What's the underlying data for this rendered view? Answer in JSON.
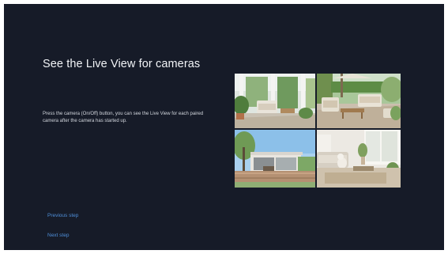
{
  "page": {
    "title": "See the Live View for cameras",
    "description": "Press the camera (On/Off) button, you can see the Live View for each paired camera after the camera has started up."
  },
  "camera_feeds": [
    {
      "name": "camera-1-porch"
    },
    {
      "name": "camera-2-patio"
    },
    {
      "name": "camera-3-deck"
    },
    {
      "name": "camera-4-living-room"
    }
  ],
  "navigation": {
    "previous_label": "Previous step",
    "next_label": "Next step"
  },
  "colors": {
    "background": "#161b28",
    "title_text": "#f2f4f7",
    "link_accent": "#4f8fd9"
  }
}
